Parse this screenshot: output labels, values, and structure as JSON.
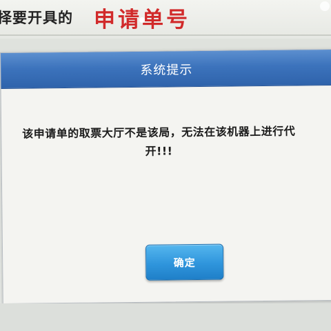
{
  "background_page": {
    "prompt_text": "择要开具的",
    "heading": "申请单号"
  },
  "dialog": {
    "title": "系统提示",
    "message_line1": "该申请单的取票大厅不是该局，无法在该机器上进行代",
    "message_line2": "开!!!",
    "ok_label": "确定"
  },
  "colors": {
    "titlebar": "#3c73bc",
    "button": "#2f95dc",
    "heading_red": "#d12a2a"
  }
}
